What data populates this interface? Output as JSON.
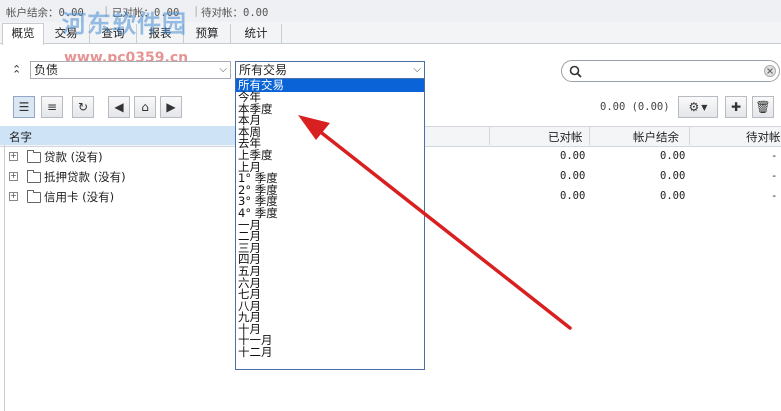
{
  "status": {
    "balance_label": "帐户结余：0.00",
    "reconciled_label": "已对帐：0.00",
    "pending_label": "待对帐：0.00"
  },
  "watermark": {
    "brand": "河东软件园",
    "url": "www.pc0359.cn"
  },
  "tabs": [
    "概览",
    "交易",
    "查询",
    "报表",
    "预算",
    "统计"
  ],
  "filters": {
    "account_type": "负债",
    "period": "所有交易"
  },
  "toolbar": {
    "summary": "0.00 (0.00)"
  },
  "table": {
    "headers": [
      "名字",
      "已对帐",
      "帐户结余",
      "待对帐"
    ],
    "rows": [
      {
        "name": "贷款 (没有)",
        "reconciled": "0.00",
        "balance": "0.00",
        "pending": "-"
      },
      {
        "name": "抵押贷款 (没有)",
        "reconciled": "0.00",
        "balance": "0.00",
        "pending": "-"
      },
      {
        "name": "信用卡 (没有)",
        "reconciled": "0.00",
        "balance": "0.00",
        "pending": "-"
      }
    ]
  },
  "period_options": [
    "所有交易",
    "今年",
    "本季度",
    "本月",
    "本周",
    "去年",
    "上季度",
    "上月",
    "1° 季度",
    "2° 季度",
    "3° 季度",
    "4° 季度",
    "一月",
    "二月",
    "三月",
    "四月",
    "五月",
    "六月",
    "七月",
    "八月",
    "九月",
    "十月",
    "十一月",
    "十二月"
  ],
  "colors": {
    "accent": "#0a64d8",
    "arrow": "#d92020"
  }
}
